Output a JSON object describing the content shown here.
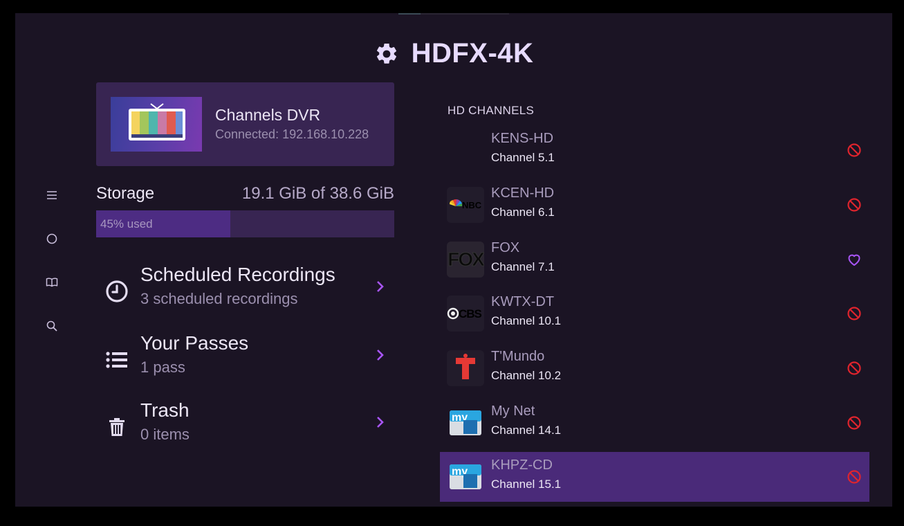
{
  "header": {
    "title": "HDFX-4K",
    "icon": "gear-icon"
  },
  "nav": [
    {
      "icon": "menu-icon"
    },
    {
      "icon": "circle-icon"
    },
    {
      "icon": "book-icon"
    },
    {
      "icon": "search-icon"
    }
  ],
  "dvr": {
    "name": "Channels DVR",
    "status": "Connected: 192.168.10.228"
  },
  "storage": {
    "label": "Storage",
    "value": "19.1 GiB of 38.6 GiB",
    "used_text": "45% used",
    "used_fraction": 0.45
  },
  "menu": [
    {
      "title": "Scheduled Recordings",
      "subtitle": "3 scheduled recordings",
      "icon": "clock-icon"
    },
    {
      "title": "Your Passes",
      "subtitle": "1 pass",
      "icon": "list-icon"
    },
    {
      "title": "Trash",
      "subtitle": "0 items",
      "icon": "trash-icon"
    }
  ],
  "channels": {
    "heading": "HD CHANNELS",
    "items": [
      {
        "name": "KENS-HD",
        "number": "Channel 5.1",
        "logo": "",
        "action": "block-icon"
      },
      {
        "name": "KCEN-HD",
        "number": "Channel 6.1",
        "logo": "NBC",
        "action": "block-icon"
      },
      {
        "name": "FOX",
        "number": "Channel 7.1",
        "logo": "FOX",
        "action": "heart-icon"
      },
      {
        "name": "KWTX-DT",
        "number": "Channel 10.1",
        "logo": "CBS",
        "action": "block-icon"
      },
      {
        "name": "T'Mundo",
        "number": "Channel 10.2",
        "logo": "T",
        "action": "block-icon"
      },
      {
        "name": "My Net",
        "number": "Channel 14.1",
        "logo": "my",
        "action": "block-icon"
      },
      {
        "name": "KHPZ-CD",
        "number": "Channel 15.1",
        "logo": "my",
        "action": "block-icon",
        "selected": true
      }
    ]
  },
  "colors": {
    "accent": "#a855f7",
    "block": "#e0242d",
    "selected_row": "#4a2a79",
    "card": "#382552",
    "background": "#1b1424"
  }
}
